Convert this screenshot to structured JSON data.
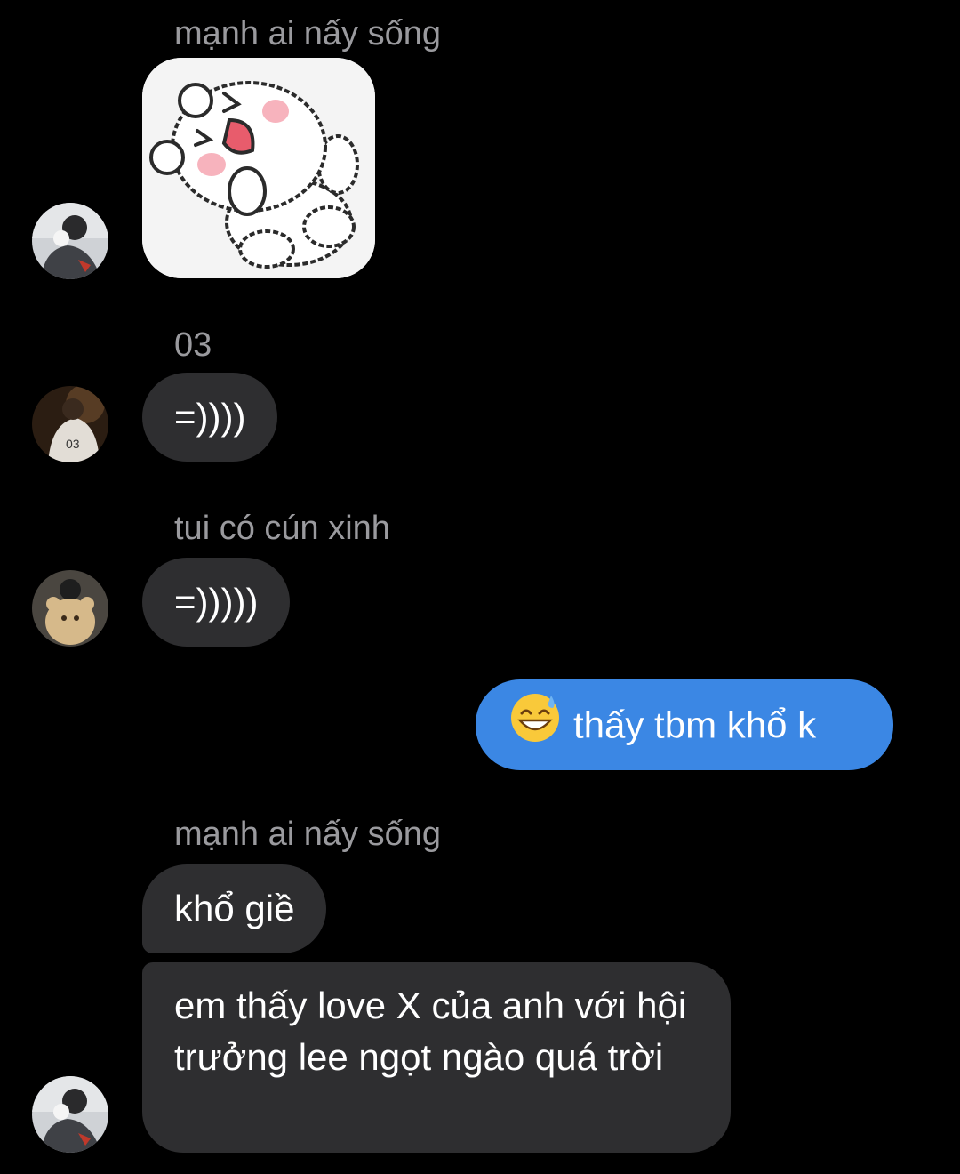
{
  "messages": [
    {
      "sender": "mạnh ai nấy sống",
      "sticker_icon": "laughing-bear-sticker"
    },
    {
      "sender": "03",
      "text": "=))))"
    },
    {
      "sender": "tui có cún xinh",
      "text": "=)))))"
    },
    {
      "outgoing": true,
      "emoji_icon": "grinning-face-with-sweat-icon",
      "text": "thấy tbm khổ k"
    },
    {
      "sender": "mạnh ai nấy sống",
      "text": "khổ giề"
    },
    {
      "text": "em thấy love X của anh với hội trưởng lee ngọt ngào quá trời"
    }
  ],
  "colors": {
    "background": "#000000",
    "incoming_bubble": "#2e2e30",
    "outgoing_bubble": "#3b87e4",
    "sender_name": "#9a9a9e"
  }
}
